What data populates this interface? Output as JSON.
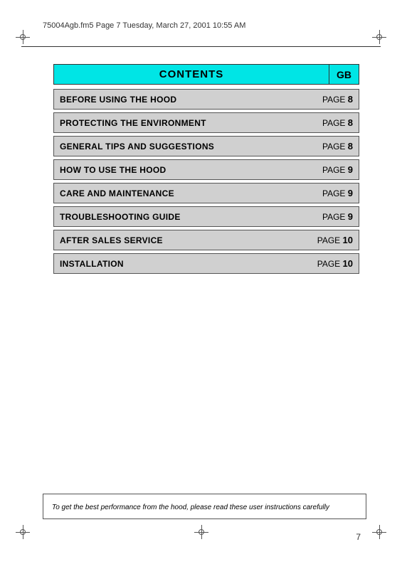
{
  "header": {
    "filename": "75004Agb.fm5  Page 7  Tuesday, March 27, 2001  10:55 AM"
  },
  "contents": {
    "title": "CONTENTS",
    "gb_label": "GB"
  },
  "toc": {
    "rows": [
      {
        "label": "BEFORE USING THE HOOD",
        "page_prefix": "PAGE",
        "page_num": "8"
      },
      {
        "label": "PROTECTING THE ENVIRONMENT",
        "page_prefix": "PAGE",
        "page_num": "8"
      },
      {
        "label": "GENERAL TIPS AND SUGGESTIONS",
        "page_prefix": "PAGE",
        "page_num": "8"
      },
      {
        "label": "HOW TO USE THE HOOD",
        "page_prefix": "PAGE",
        "page_num": "9"
      },
      {
        "label": "CARE AND MAINTENANCE",
        "page_prefix": "PAGE",
        "page_num": "9"
      },
      {
        "label": "TROUBLESHOOTING GUIDE",
        "page_prefix": "PAGE",
        "page_num": "9"
      },
      {
        "label": "AFTER SALES SERVICE",
        "page_prefix": "PAGE",
        "page_num": "10"
      },
      {
        "label": "INSTALLATION",
        "page_prefix": "PAGE",
        "page_num": "10"
      }
    ]
  },
  "bottom_note": {
    "text": "To get the best performance from the hood, please read these user instructions carefully"
  },
  "page_number": "7"
}
